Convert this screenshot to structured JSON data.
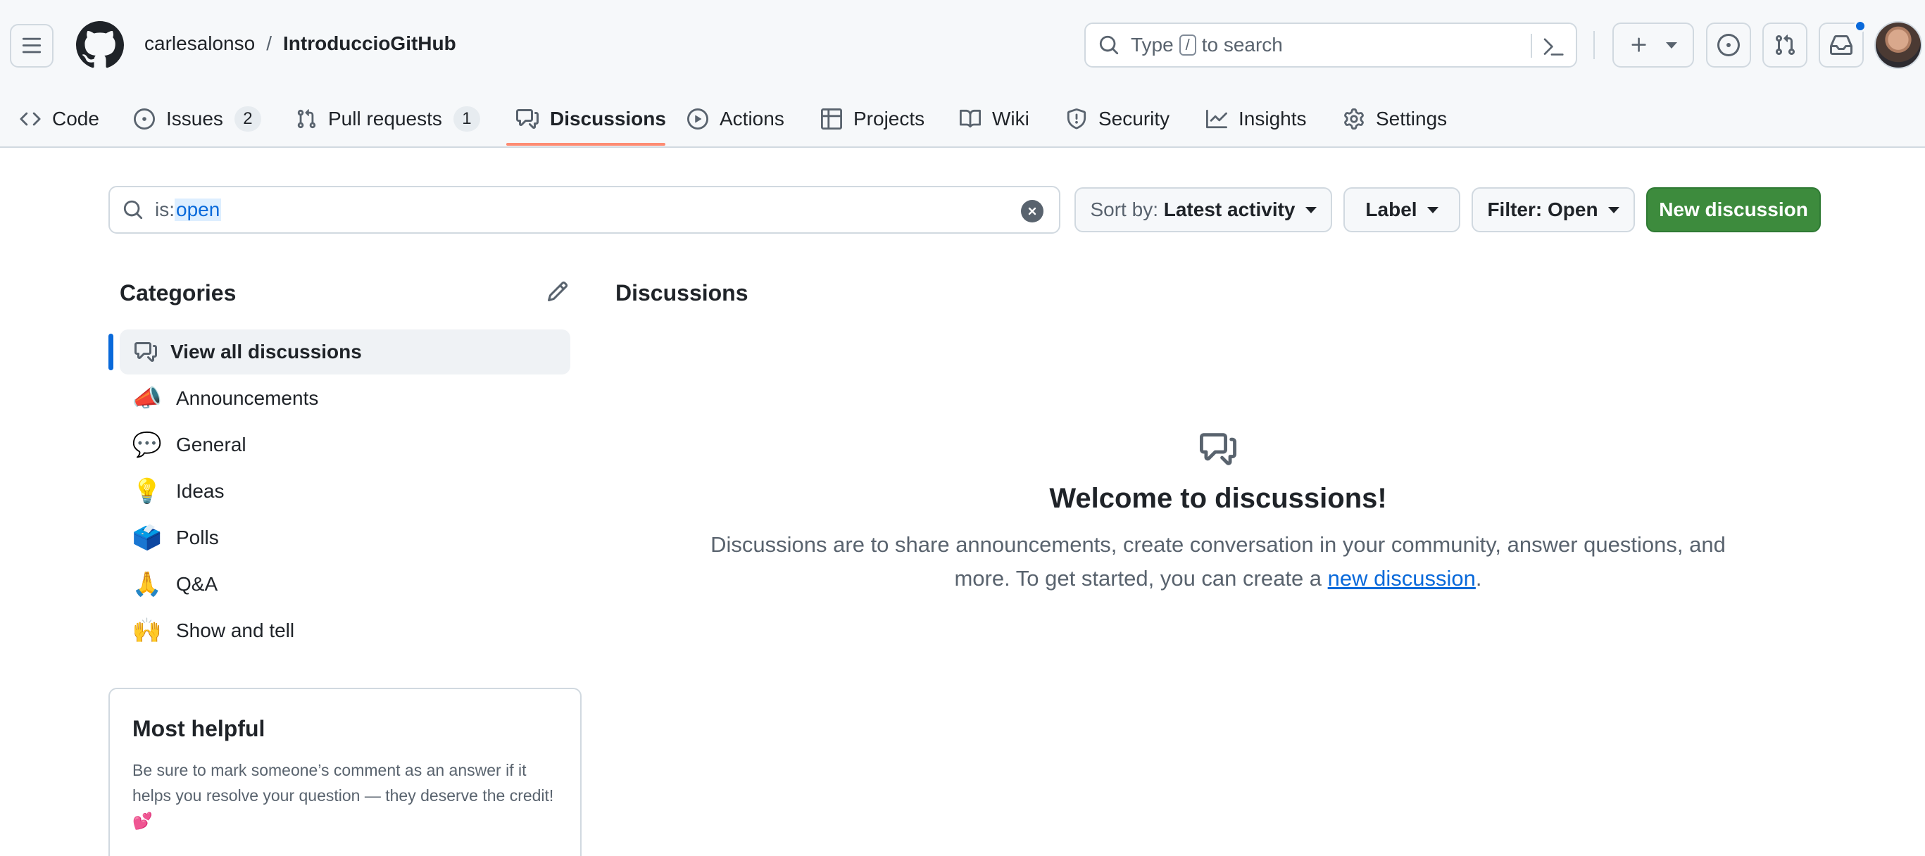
{
  "header": {
    "owner": "carlesalonso",
    "separator": "/",
    "repo": "IntroduccioGitHub",
    "search": {
      "prefix": "Type",
      "key": "/",
      "suffix": "to search"
    }
  },
  "icons": {
    "menu": "hamburger-icon",
    "logo": "github-mark-icon",
    "search": "search-icon",
    "command": "terminal-icon",
    "create": "plus-icon",
    "issues": "issue-opened-icon",
    "pulls": "git-pull-request-icon",
    "inbox": "inbox-icon"
  },
  "tabs": [
    {
      "label": "Code",
      "icon": "code-icon"
    },
    {
      "label": "Issues",
      "icon": "issue-opened-icon",
      "count": "2"
    },
    {
      "label": "Pull requests",
      "icon": "git-pull-request-icon",
      "count": "1"
    },
    {
      "label": "Discussions",
      "icon": "comment-discussion-icon",
      "active": true
    },
    {
      "label": "Actions",
      "icon": "play-icon"
    },
    {
      "label": "Projects",
      "icon": "table-icon"
    },
    {
      "label": "Wiki",
      "icon": "book-icon"
    },
    {
      "label": "Security",
      "icon": "shield-icon"
    },
    {
      "label": "Insights",
      "icon": "graph-icon"
    },
    {
      "label": "Settings",
      "icon": "gear-icon"
    }
  ],
  "filter": {
    "value_prefix": "is:",
    "value_highlight": "open",
    "sort_label": "Sort by:",
    "sort_value": "Latest activity",
    "label_button": "Label",
    "filter_button": "Filter: Open",
    "new_button": "New discussion"
  },
  "sidebar": {
    "title": "Categories",
    "items": [
      {
        "label": "View all discussions",
        "emoji": "",
        "active": true
      },
      {
        "label": "Announcements",
        "emoji": "📣"
      },
      {
        "label": "General",
        "emoji": "💬"
      },
      {
        "label": "Ideas",
        "emoji": "💡"
      },
      {
        "label": "Polls",
        "emoji": "🗳️"
      },
      {
        "label": "Q&A",
        "emoji": "🙏"
      },
      {
        "label": "Show and tell",
        "emoji": "🙌"
      }
    ],
    "helpful": {
      "title": "Most helpful",
      "text": "Be sure to mark someone’s comment as an answer if it helps you resolve your question — they deserve the credit!",
      "emoji": "💕"
    }
  },
  "main": {
    "title": "Discussions",
    "welcome": "Welcome to discussions!",
    "desc_before": "Discussions are to share announcements, create conversation in your community, answer questions, and more. To get started, you can create a",
    "desc_link": "new discussion",
    "desc_after": "."
  },
  "colors": {
    "accent": "#0969da",
    "tab_underline": "#fd8c73",
    "primary_button": "#3d8b3d",
    "header_bg": "#f6f8fa"
  }
}
